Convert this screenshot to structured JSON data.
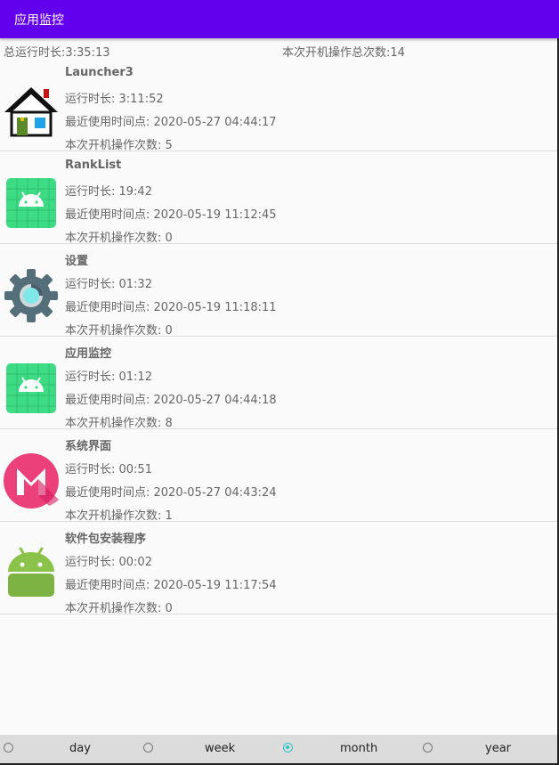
{
  "app_bar": {
    "title": "应用监控"
  },
  "summary": {
    "total_runtime": "总运行时长:3:35:13",
    "total_ops": "本次开机操作总次数:14"
  },
  "apps": [
    {
      "name": "Launcher3",
      "runtime": "运行时长: 3:11:52",
      "last_used": "最近使用时间点: 2020-05-27 04:44:17",
      "ops": "本次开机操作次数: 5",
      "icon": "launcher-house-icon"
    },
    {
      "name": "RankList",
      "runtime": "运行时长: 19:42",
      "last_used": "最近使用时间点: 2020-05-19 11:12:45",
      "ops": "本次开机操作次数: 0",
      "icon": "android-app-icon"
    },
    {
      "name": "设置",
      "runtime": "运行时长: 01:32",
      "last_used": "最近使用时间点: 2020-05-19 11:18:11",
      "ops": "本次开机操作次数: 0",
      "icon": "settings-gear-icon"
    },
    {
      "name": "应用监控",
      "runtime": "运行时长: 01:12",
      "last_used": "最近使用时间点: 2020-05-27 04:44:18",
      "ops": "本次开机操作次数: 8",
      "icon": "android-app-icon"
    },
    {
      "name": "系统界面",
      "runtime": "运行时长: 00:51",
      "last_used": "最近使用时间点: 2020-05-27 04:43:24",
      "ops": "本次开机操作次数: 1",
      "icon": "marshmallow-icon"
    },
    {
      "name": "软件包安装程序",
      "runtime": "运行时长: 00:02",
      "last_used": "最近使用时间点: 2020-05-19 11:17:54",
      "ops": "本次开机操作次数: 0",
      "icon": "android-robot-icon"
    }
  ],
  "bottom_bar": {
    "options": [
      {
        "label": "day",
        "checked": false
      },
      {
        "label": "week",
        "checked": false
      },
      {
        "label": "month",
        "checked": true
      },
      {
        "label": "year",
        "checked": false
      }
    ]
  },
  "colors": {
    "app_bar": "#6200ee",
    "radio_accent": "#26c6ca"
  }
}
